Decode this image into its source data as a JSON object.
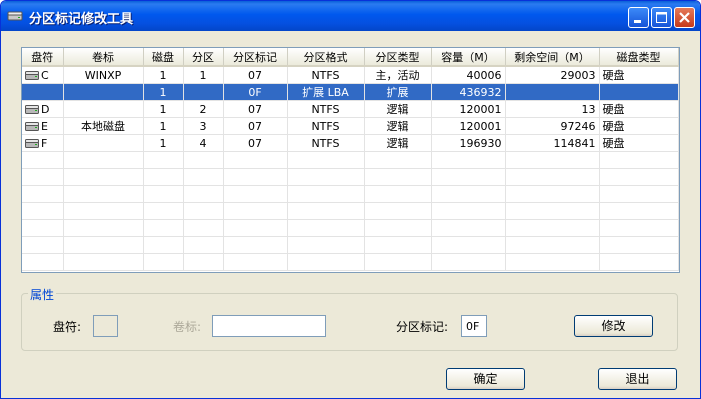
{
  "window": {
    "title": "分区标记修改工具"
  },
  "table": {
    "columns": [
      "盘符",
      "卷标",
      "磁盘",
      "分区",
      "分区标记",
      "分区格式",
      "分区类型",
      "容量（M）",
      "剩余空间（M）",
      "磁盘类型"
    ],
    "rows": [
      {
        "drive": "C",
        "label": "WINXP",
        "disk": "1",
        "part": "1",
        "mark": "07",
        "fmt": "NTFS",
        "type": "主，活动",
        "size": "40006",
        "free": "29003",
        "dtype": "硬盘",
        "icon": true
      },
      {
        "drive": "",
        "label": "",
        "disk": "1",
        "part": "",
        "mark": "0F",
        "fmt": "扩展 LBA",
        "type": "扩展",
        "size": "436932",
        "free": "",
        "dtype": "",
        "icon": false
      },
      {
        "drive": "D",
        "label": "",
        "disk": "1",
        "part": "2",
        "mark": "07",
        "fmt": "NTFS",
        "type": "逻辑",
        "size": "120001",
        "free": "13",
        "dtype": "硬盘",
        "icon": true
      },
      {
        "drive": "E",
        "label": "本地磁盘",
        "disk": "1",
        "part": "3",
        "mark": "07",
        "fmt": "NTFS",
        "type": "逻辑",
        "size": "120001",
        "free": "97246",
        "dtype": "硬盘",
        "icon": true
      },
      {
        "drive": "F",
        "label": "",
        "disk": "1",
        "part": "4",
        "mark": "07",
        "fmt": "NTFS",
        "type": "逻辑",
        "size": "196930",
        "free": "114841",
        "dtype": "硬盘",
        "icon": true
      }
    ],
    "selected_row": 1,
    "empty_rows": 7
  },
  "properties": {
    "legend": "属性",
    "drive_label": "盘符:",
    "drive_value": "",
    "volume_label": "卷标:",
    "volume_value": "",
    "mark_label": "分区标记:",
    "mark_value": "0F",
    "modify_button": "修改"
  },
  "buttons": {
    "ok": "确定",
    "exit": "退出"
  },
  "colors": {
    "selection": "#316ac5",
    "titlebar": "#0058ee",
    "legend": "#0046d5"
  }
}
